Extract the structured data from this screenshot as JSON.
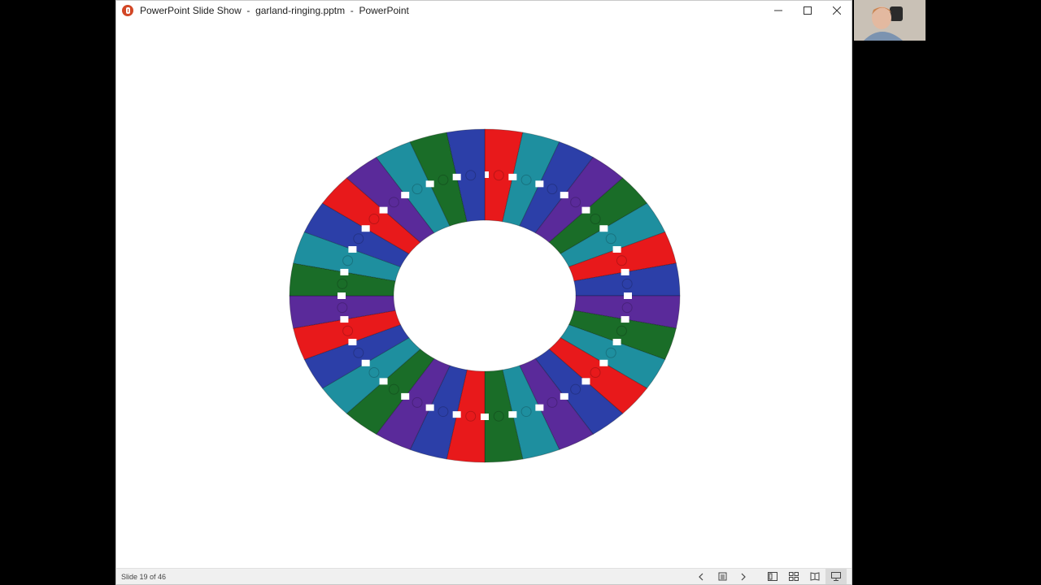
{
  "window": {
    "title": "PowerPoint Slide Show  -  garland-ringing.pptm  -  PowerPoint",
    "app_icon": "powerpoint-icon",
    "controls": {
      "minimize": "minimize-icon",
      "maximize": "maximize-icon",
      "close": "close-icon"
    }
  },
  "status": {
    "slide_counter": "Slide 19 of 46"
  },
  "nav": {
    "icons": [
      "previous-icon",
      "slide-list-icon",
      "next-icon",
      "normal-view-icon",
      "slide-sorter-icon",
      "reading-view-icon",
      "slideshow-icon"
    ],
    "active_view": "slideshow-icon"
  },
  "slide": {
    "image": "garland-ring-puzzle-image",
    "colors": [
      "#e8191b",
      "#1e8f9f",
      "#2c3fa8",
      "#5a2a9a",
      "#1a6d28"
    ]
  }
}
